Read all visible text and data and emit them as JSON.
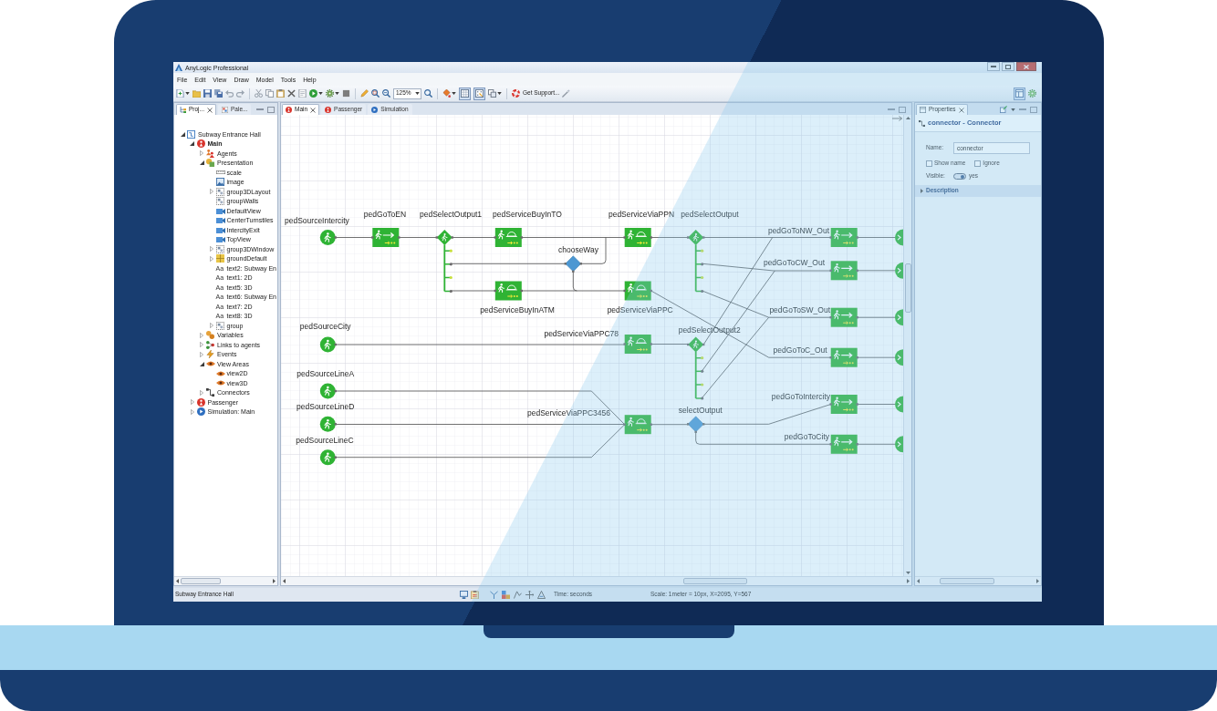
{
  "window": {
    "title": "AnyLogic Professional"
  },
  "menu": [
    "File",
    "Edit",
    "View",
    "Draw",
    "Model",
    "Tools",
    "Help"
  ],
  "toolbar": {
    "zoom": "125%",
    "support": "Get Support...",
    "toggles": [
      {
        "kind": "grid",
        "pressed": true
      },
      {
        "kind": "snap",
        "pressed": true
      }
    ],
    "perspective": {
      "pressed": true
    }
  },
  "left_panel": {
    "tabs": [
      {
        "kind": "project",
        "label": "Proj...",
        "selected": true
      },
      {
        "kind": "palette",
        "label": "Pale...",
        "selected": false
      }
    ],
    "tree": [
      {
        "kind": "model",
        "label": "Subway Entrance Hall",
        "expanded": true,
        "children": [
          {
            "kind": "agent-type",
            "label": "Main",
            "active": true,
            "expanded": true,
            "children": [
              {
                "kind": "agents",
                "label": "Agents",
                "expanded": false
              },
              {
                "kind": "presentation",
                "label": "Presentation",
                "expanded": true,
                "children": [
                  {
                    "kind": "ruler",
                    "label": "scale"
                  },
                  {
                    "kind": "image",
                    "label": "image"
                  },
                  {
                    "kind": "group",
                    "label": "group3DLayout",
                    "expanded": false
                  },
                  {
                    "kind": "group",
                    "label": "groupWalls"
                  },
                  {
                    "kind": "view",
                    "label": "DefaultView"
                  },
                  {
                    "kind": "view",
                    "label": "CenterTurnstiles"
                  },
                  {
                    "kind": "view",
                    "label": "IntercityExit"
                  },
                  {
                    "kind": "view",
                    "label": "TopView"
                  },
                  {
                    "kind": "group",
                    "label": "group3DWindow",
                    "expanded": false
                  },
                  {
                    "kind": "ground",
                    "label": "groundDefault",
                    "expanded": false
                  },
                  {
                    "kind": "text",
                    "glyph": "Aa",
                    "label": "text2: Subway En"
                  },
                  {
                    "kind": "text",
                    "glyph": "Aa",
                    "label": "text1: 2D"
                  },
                  {
                    "kind": "text",
                    "glyph": "Aa",
                    "label": "text5: 3D"
                  },
                  {
                    "kind": "text",
                    "glyph": "Aa",
                    "label": "text6: Subway En"
                  },
                  {
                    "kind": "text",
                    "glyph": "Aa",
                    "label": "text7: 2D"
                  },
                  {
                    "kind": "text",
                    "glyph": "Aa",
                    "label": "text8: 3D"
                  },
                  {
                    "kind": "group",
                    "label": "group",
                    "expanded": false
                  }
                ]
              },
              {
                "kind": "variables",
                "label": "Variables",
                "expanded": false
              },
              {
                "kind": "links",
                "label": "Links to agents",
                "expanded": false
              },
              {
                "kind": "events",
                "label": "Events",
                "expanded": false
              },
              {
                "kind": "view-areas",
                "label": "View Areas",
                "expanded": true,
                "children": [
                  {
                    "kind": "view-area",
                    "label": "view2D"
                  },
                  {
                    "kind": "view-area",
                    "label": "view3D"
                  }
                ]
              },
              {
                "kind": "connectors",
                "label": "Connectors",
                "expanded": false
              }
            ]
          },
          {
            "kind": "agent-type",
            "label": "Passenger",
            "active": false,
            "expanded": false
          },
          {
            "kind": "experiment",
            "label": "Simulation: Main",
            "active": false,
            "expanded": false
          }
        ]
      }
    ]
  },
  "editor": {
    "tabs": [
      {
        "kind": "agent",
        "label": "Main",
        "selected": true
      },
      {
        "kind": "agent",
        "label": "Passenger",
        "selected": false
      },
      {
        "kind": "experiment",
        "label": "Simulation",
        "selected": false
      }
    ],
    "diagram": {
      "nodes": [
        {
          "kind": "source",
          "label": "pedSourceIntercity"
        },
        {
          "kind": "goto",
          "label": "pedGoToEN"
        },
        {
          "kind": "select",
          "label": "pedSelectOutput1"
        },
        {
          "kind": "service",
          "label": "pedServiceBuyInTO"
        },
        {
          "kind": "decision",
          "label": "chooseWay"
        },
        {
          "kind": "service",
          "label": "pedServiceBuyInATM"
        },
        {
          "kind": "service",
          "label": "pedServiceViaPPN"
        },
        {
          "kind": "select",
          "label": "pedSelectOutput"
        },
        {
          "kind": "service",
          "label": "pedServiceViaPPC"
        },
        {
          "kind": "goto",
          "label": "pedGoToNW_Out"
        },
        {
          "kind": "goto",
          "label": "pedGoToCW_Out"
        },
        {
          "kind": "goto",
          "label": "pedGoToSW_Out"
        },
        {
          "kind": "goto",
          "label": "pedGoToC_Out"
        },
        {
          "kind": "source",
          "label": "pedSourceCity"
        },
        {
          "kind": "service",
          "label": "pedServiceViaPPC78"
        },
        {
          "kind": "select",
          "label": "pedSelectOutput2"
        },
        {
          "kind": "source",
          "label": "pedSourceLineA"
        },
        {
          "kind": "source",
          "label": "pedSourceLineD"
        },
        {
          "kind": "source",
          "label": "pedSourceLineC"
        },
        {
          "kind": "service",
          "label": "pedServiceViaPPC3456"
        },
        {
          "kind": "decision",
          "label": "selectOutput"
        },
        {
          "kind": "goto",
          "label": "pedGoToIntercity"
        },
        {
          "kind": "goto",
          "label": "pedGoToCity"
        },
        {
          "kind": "sink"
        },
        {
          "kind": "sink"
        },
        {
          "kind": "sink"
        },
        {
          "kind": "sink"
        },
        {
          "kind": "sink"
        },
        {
          "kind": "sink"
        }
      ]
    }
  },
  "properties": {
    "tab": {
      "label": "Properties",
      "selected": true
    },
    "title": "connector - Connector",
    "fields": [
      {
        "label": "Name:",
        "value": "connector"
      }
    ],
    "checkboxes": [
      {
        "label": "Show name",
        "checked": false
      },
      {
        "label": "Ignore",
        "checked": false
      }
    ],
    "toggle": {
      "label": "Visible:",
      "on": true,
      "text": "yes"
    },
    "sections": [
      {
        "label": "Description",
        "expanded": false
      }
    ]
  },
  "status_bar": {
    "text": "Subway Entrance Hall",
    "time": "Time: seconds",
    "scale": "Scale: 1meter = 10px, X=2095, Y=567"
  }
}
